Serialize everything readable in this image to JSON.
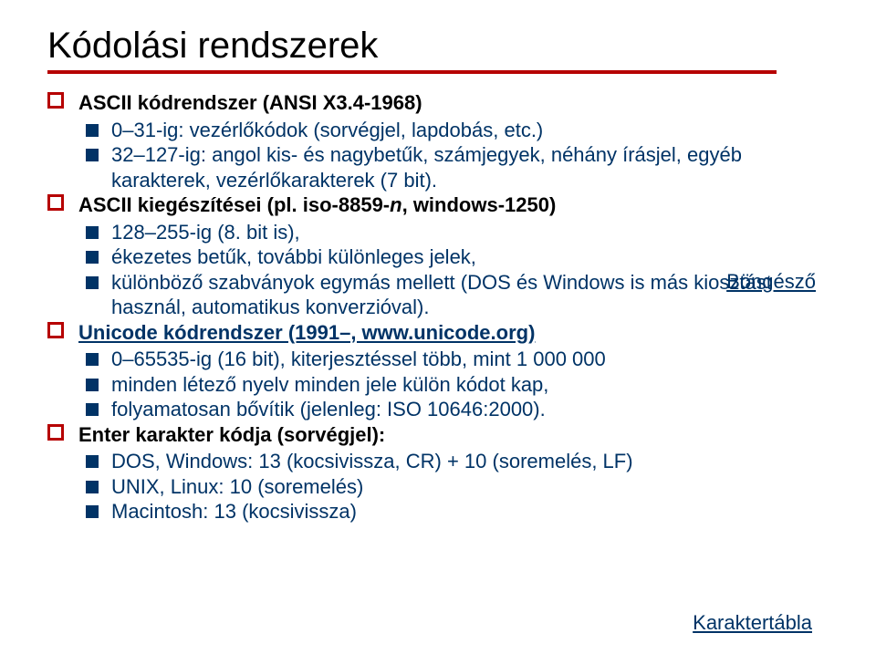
{
  "title": "Kódolási rendszerek",
  "items": [
    {
      "level": 1,
      "cls": "bold black",
      "text": "ASCII kódrendszer (ANSI X3.4-1968)"
    },
    {
      "level": 2,
      "cls": "navy",
      "text": "0–31-ig: vezérlőkódok (sorvégjel, lapdobás, etc.)"
    },
    {
      "level": 2,
      "cls": "navy",
      "text": "32–127-ig: angol kis- és nagybetűk, számjegyek, néhány írásjel, egyéb karakterek, vezérlőkarakterek (7 bit)."
    },
    {
      "level": 1,
      "cls": "bold black",
      "html": "ASCII kiegészítései (pl. iso-8859-<span class='ital'>n</span>, windows-1250)"
    },
    {
      "level": 2,
      "cls": "navy",
      "text": "128–255-ig (8. bit is),"
    },
    {
      "level": 2,
      "cls": "navy",
      "text": "ékezetes betűk, további különleges jelek,"
    },
    {
      "level": 2,
      "cls": "navy",
      "text": "különböző szabványok egymás mellett (DOS és Windows is más kiosztást használ, automatikus konverzióval)."
    },
    {
      "level": 1,
      "cls": "bold navy linklike",
      "text": "Unicode kódrendszer (1991–, www.unicode.org)"
    },
    {
      "level": 2,
      "cls": "navy",
      "text": "0–65535-ig (16 bit), kiterjesztéssel több, mint 1 000 000"
    },
    {
      "level": 2,
      "cls": "navy",
      "text": "minden létező nyelv minden jele külön kódot kap,"
    },
    {
      "level": 2,
      "cls": "navy",
      "text": "folyamatosan bővítik (jelenleg: ISO 10646:2000)."
    },
    {
      "level": 1,
      "cls": "bold black",
      "text": "Enter karakter kódja (sorvégjel):"
    },
    {
      "level": 2,
      "cls": "navy",
      "text": "DOS, Windows: 13 (kocsivissza, CR) + 10 (soremelés, LF)"
    },
    {
      "level": 2,
      "cls": "navy",
      "text": "UNIX, Linux: 10 (soremelés)"
    },
    {
      "level": 2,
      "cls": "navy",
      "text": "Macintosh: 13 (kocsivissza)"
    }
  ],
  "floatLinks": {
    "browser": "Böngésző",
    "chartable": "Karaktertábla"
  }
}
